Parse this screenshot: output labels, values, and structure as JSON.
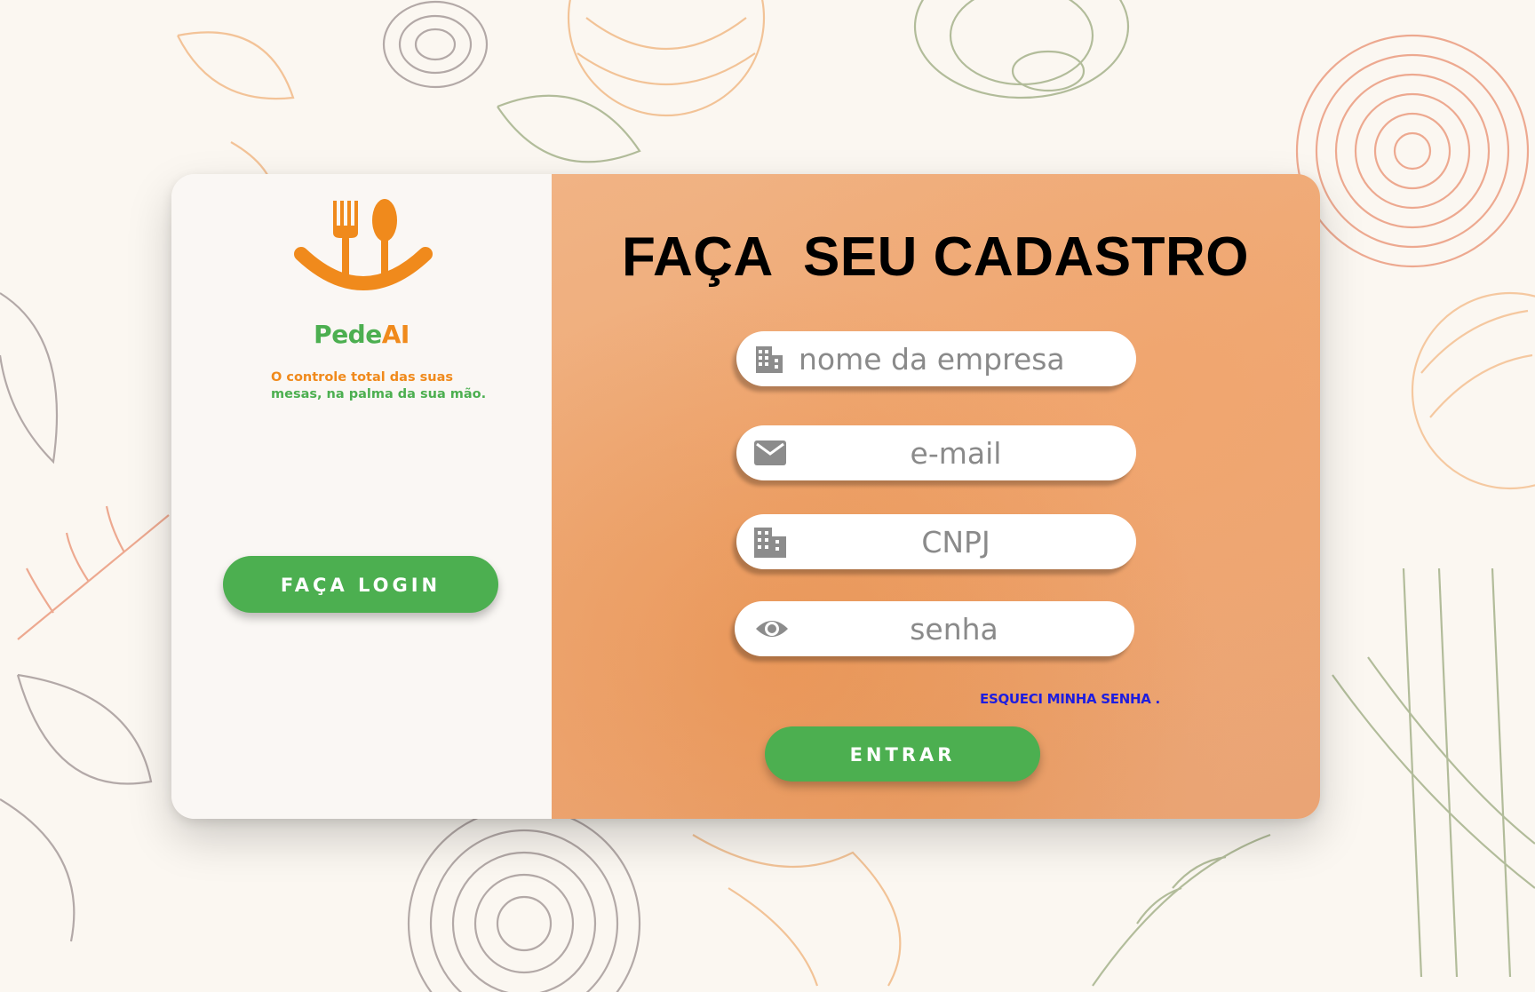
{
  "brand": {
    "name_part1": "Pede",
    "name_part2": "AI",
    "tagline_line1": "O controle total das suas",
    "tagline_line2": "mesas, na palma da sua mão.",
    "colors": {
      "green": "#4caf50",
      "orange": "#f08a1c"
    }
  },
  "left_panel": {
    "login_button": "FAÇA LOGIN"
  },
  "form": {
    "title": "FAÇA  SEU CADASTRO",
    "fields": [
      {
        "icon": "building-icon",
        "placeholder": "nome da empresa"
      },
      {
        "icon": "mail-icon",
        "placeholder": "e-mail"
      },
      {
        "icon": "building-icon",
        "placeholder": "CNPJ"
      },
      {
        "icon": "eye-icon",
        "placeholder": "senha"
      }
    ],
    "forgot_link": "ESQUECI MINHA SENHA .",
    "submit_button": "ENTRAR"
  },
  "theme": {
    "panel_left": "#faf7f4",
    "panel_right": "#eeaa77",
    "link_color": "#1d1de0"
  }
}
